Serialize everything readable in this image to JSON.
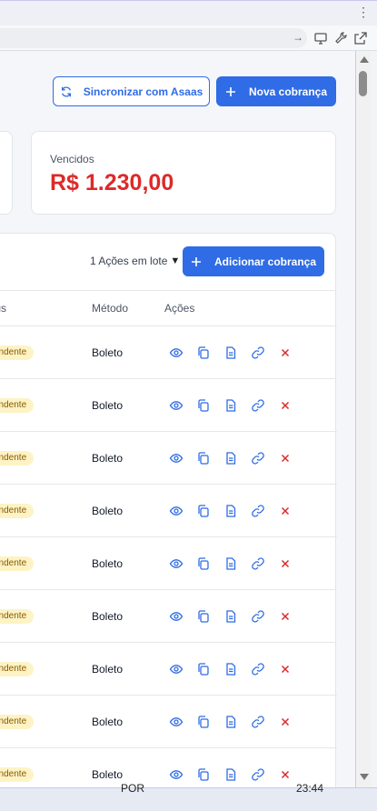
{
  "browser": {
    "menu_glyph": "⋮",
    "nav_arrow": "→",
    "icons": [
      "desktop-icon",
      "wrench-icon",
      "open-external-icon"
    ]
  },
  "header": {
    "sync_label": "Sincronizar com Asaas",
    "new_label": "Nova cobrança"
  },
  "summary": {
    "label": "Vencidos",
    "value": "R$ 1.230,00",
    "value_color": "#dc2a2a"
  },
  "table": {
    "bulk_label": "1 Ações em lote",
    "caret": "▼",
    "add_label": "Adicionar cobrança",
    "columns": {
      "status": "tus",
      "method": "Método",
      "actions": "Ações"
    },
    "rows": [
      {
        "status": "endente",
        "method": "Boleto"
      },
      {
        "status": "endente",
        "method": "Boleto"
      },
      {
        "status": "endente",
        "method": "Boleto"
      },
      {
        "status": "endente",
        "method": "Boleto"
      },
      {
        "status": "endente",
        "method": "Boleto"
      },
      {
        "status": "endente",
        "method": "Boleto"
      },
      {
        "status": "endente",
        "method": "Boleto"
      },
      {
        "status": "endente",
        "method": "Boleto"
      },
      {
        "status": "endente",
        "method": "Boleto"
      }
    ],
    "row_actions": [
      "eye-icon",
      "copy-icon",
      "document-icon",
      "link-icon",
      "close-icon"
    ]
  },
  "taskbar": {
    "lang": "POR",
    "time": "23:44"
  },
  "colors": {
    "accent": "#2f6ce5",
    "danger": "#dc2a2a",
    "badge_bg": "#fdf3c5"
  }
}
